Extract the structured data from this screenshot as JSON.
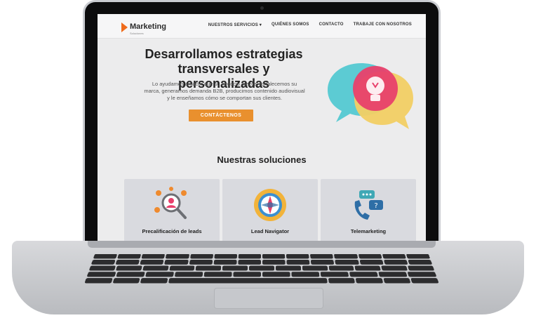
{
  "header": {
    "logo_title": "Marketing",
    "logo_subtitle": "Soluciones",
    "nav": [
      "NUESTROS SERVICIOS ▾",
      "QUIÉNES SOMOS",
      "CONTACTO",
      "TRABAJE CON NOSOTROS"
    ]
  },
  "hero": {
    "title": "Desarrollamos estrategias transversales y personalizadas",
    "text": "Lo ayudamos a hacer que su negocio crezca: fortalecemos su marca, generamos demanda B2B, producimos contenido audiovisual y le enseñamos cómo se comportan sus clientes.",
    "cta": "CONTÁCTENOS"
  },
  "solutions": {
    "title": "Nuestras soluciones",
    "cards": [
      {
        "label": "Precalificación de leads",
        "icon": "user-search-icon"
      },
      {
        "label": "Lead Navigator",
        "icon": "compass-icon"
      },
      {
        "label": "Telemarketing",
        "icon": "phone-chat-icon"
      }
    ]
  },
  "colors": {
    "accent": "#e9902e",
    "bubble_cyan": "#5ccbd3",
    "bubble_pink": "#e8406b",
    "bubble_yellow": "#f2cf64"
  }
}
